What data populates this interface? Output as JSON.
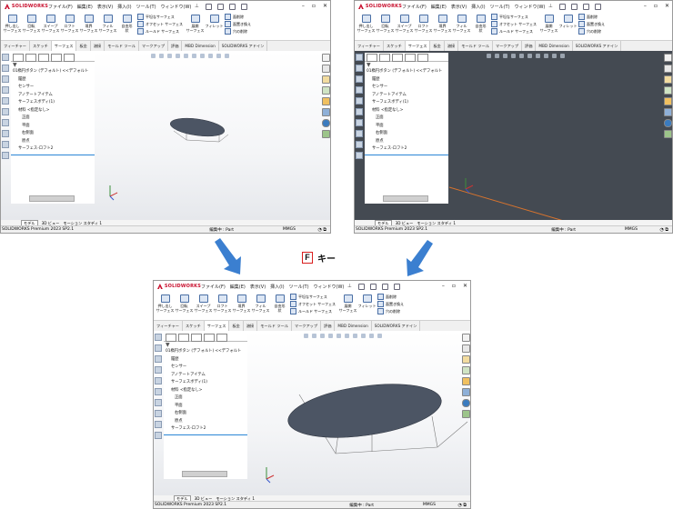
{
  "app": {
    "logo_text": "SOLIDWORKS",
    "menu": [
      "ファイル(F)",
      "編集(E)",
      "表示(V)",
      "挿入(I)",
      "ツール(T)",
      "ウィンドウ(W)"
    ],
    "ribbon_big": [
      "押し出し\nサーフェス",
      "回転\nサーフェス",
      "スイープ\nサーフェス",
      "ロフト\nサーフェス",
      "境界\nサーフェス",
      "フィル\nサーフェス",
      "自由形\n状"
    ],
    "ribbon_small_col1": [
      "平坦なサーフェス",
      "オフセット サーフェス",
      "ルールド サーフェス"
    ],
    "ribbon_extra": [
      "展開\nサーフェス",
      "フィレット"
    ],
    "ribbon_small_col2": [
      "面削除",
      "面置き換え",
      "穴の削除"
    ],
    "tabs": [
      "フィーチャー",
      "スケッチ",
      "サーフェス",
      "板金",
      "溶接",
      "モールド ツール",
      "マークアップ",
      "評価",
      "MBD Dimension",
      "SOLIDWORKS アドイン"
    ],
    "active_tab": "サーフェス",
    "tree": {
      "root": "01楕円ボタン (デフォルト) <<デフォルト",
      "items": [
        "履歴",
        "センサー",
        "アノテートアイテム",
        "サーフェスボディ(1)",
        "材料 <指定なし>",
        "正面",
        "平面",
        "右側面",
        "原点",
        "サーフェス-ロフト2"
      ]
    },
    "bottom_tabs": [
      "モデル",
      "3D ビュー",
      "モーション スタディ 1"
    ],
    "status": {
      "version": "SOLIDWORKS Premium 2023 SP2.1",
      "mode": "編集中 : Part",
      "units": "MMGS"
    }
  },
  "overlay": {
    "key_letter": "F",
    "key_text": "キー"
  },
  "colors": {
    "arrow": "#3b7fd0",
    "key_border": "#d91e1e",
    "dark_viewport": "#444a52",
    "ellipse": "#4c5564"
  }
}
